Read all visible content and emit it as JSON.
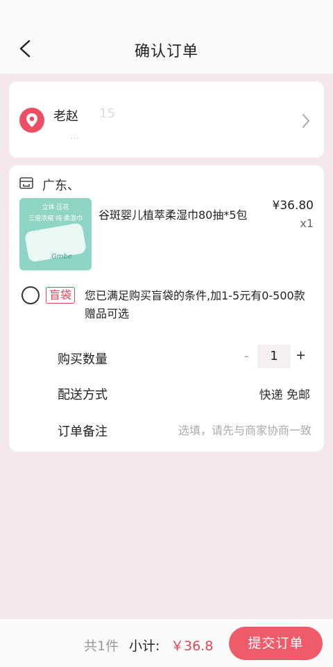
{
  "header": {
    "title": "确认订单",
    "back_icon": "chevron-left-icon"
  },
  "address": {
    "name": "老赵",
    "phone": "15 ",
    "detail": "…"
  },
  "shop": {
    "name": "广东、"
  },
  "product": {
    "title": "谷斑婴儿植萃柔湿巾80抽*5包",
    "price": "¥36.80",
    "qty": "x1",
    "image_tag": "立体 压花",
    "image_sub": "三倍浓缩 纯·柔湿巾",
    "image_brand": "Gmbe"
  },
  "bonus": {
    "badge": "盲袋",
    "text": "您已满足购买盲袋的条件,加1-5元有0-500款赠品可选"
  },
  "rows": {
    "quantity_label": "购买数量",
    "minus": "-",
    "quantity_value": "1",
    "plus": "+",
    "shipping_label": "配送方式",
    "shipping_value": "快递 免邮",
    "remark_label": "订单备注",
    "remark_placeholder": "选填，请先与商家协商一致"
  },
  "footer": {
    "count": "共1件",
    "subtotal_label": "小计:",
    "subtotal_value": "￥36.8",
    "submit": "提交订单"
  },
  "colors": {
    "accent": "#ee5b69",
    "price_red": "#e04555",
    "bg": "#f5e8ec"
  }
}
